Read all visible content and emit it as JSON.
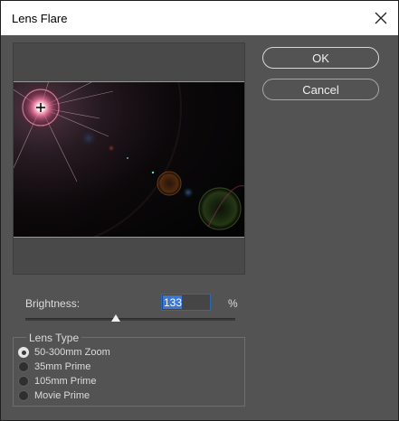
{
  "window": {
    "title": "Lens Flare"
  },
  "buttons": {
    "ok": "OK",
    "cancel": "Cancel"
  },
  "brightness": {
    "label": "Brightness:",
    "value": "133",
    "unit": "%",
    "slider_level": 0.43
  },
  "lens_type": {
    "legend": "Lens Type",
    "options": [
      {
        "label": "50-300mm Zoom",
        "selected": true
      },
      {
        "label": "35mm Prime",
        "selected": false
      },
      {
        "label": "105mm Prime",
        "selected": false
      },
      {
        "label": "Movie Prime",
        "selected": false
      }
    ]
  },
  "icons": {
    "close": "close-icon",
    "crosshair": "crosshair-icon"
  }
}
